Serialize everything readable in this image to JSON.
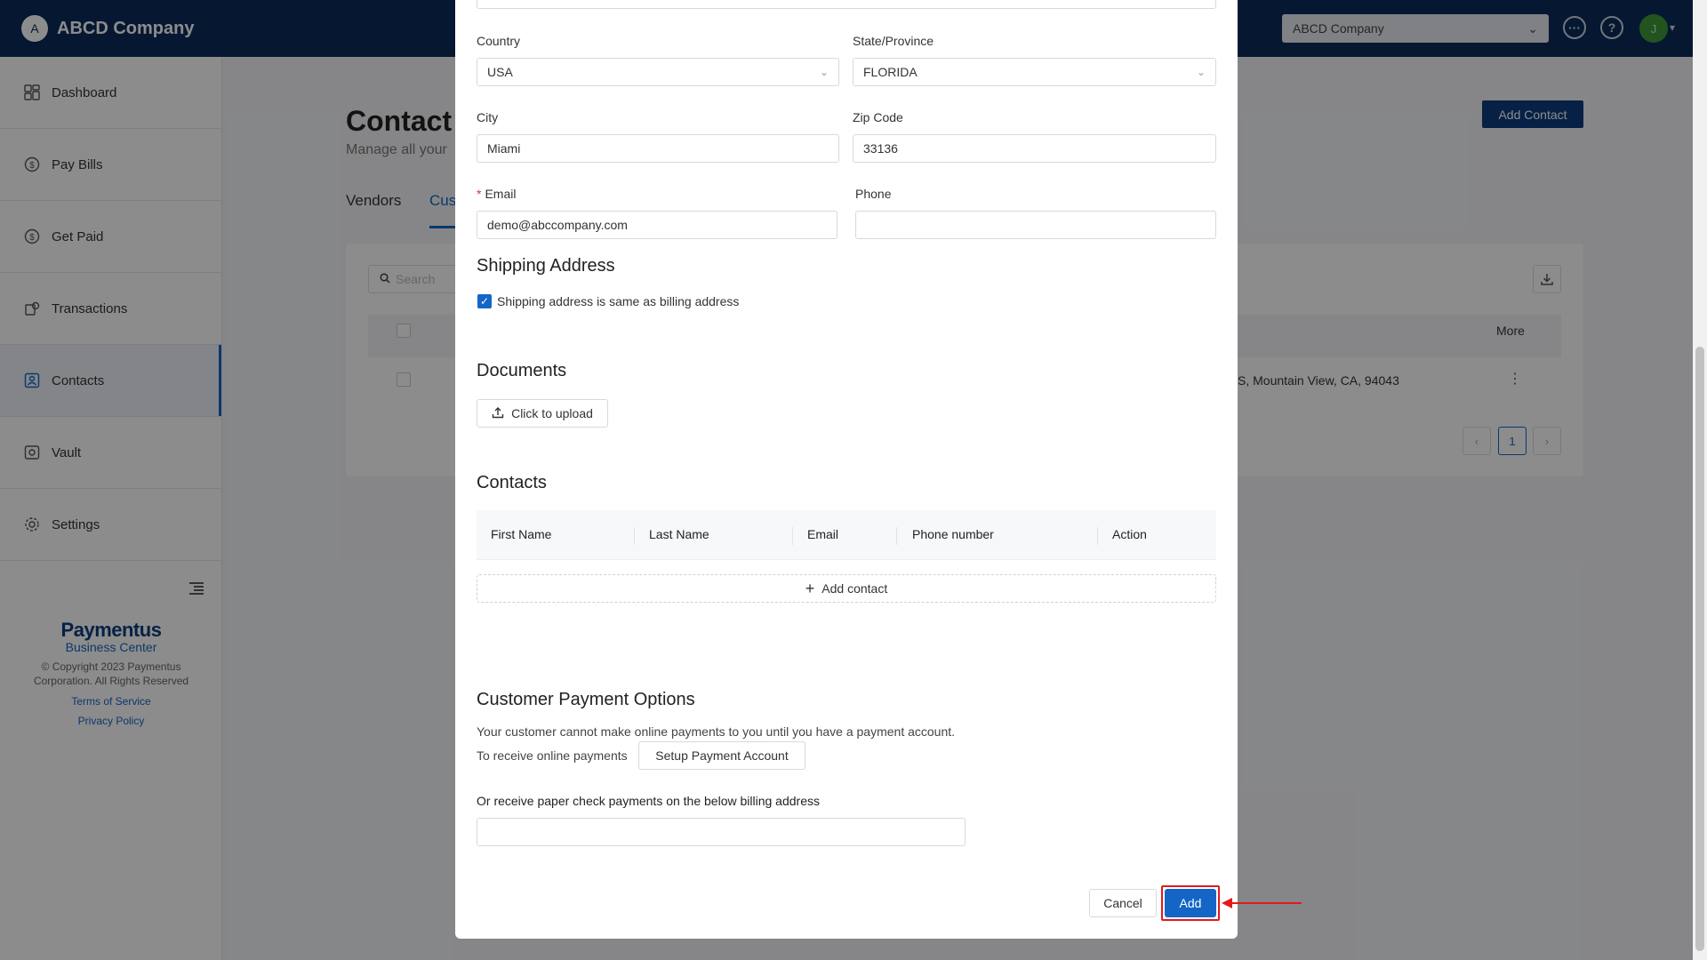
{
  "header": {
    "brand_initial": "A",
    "brand_name": "ABCD Company",
    "company_select": "ABCD Company",
    "avatar_initial": "J"
  },
  "sidebar": {
    "items": [
      {
        "label": "Dashboard",
        "icon": "dashboard-icon"
      },
      {
        "label": "Pay Bills",
        "icon": "pay-bills-icon"
      },
      {
        "label": "Get Paid",
        "icon": "get-paid-icon"
      },
      {
        "label": "Transactions",
        "icon": "transactions-icon"
      },
      {
        "label": "Contacts",
        "icon": "contacts-icon",
        "active": true
      },
      {
        "label": "Vault",
        "icon": "vault-icon"
      },
      {
        "label": "Settings",
        "icon": "settings-icon"
      }
    ],
    "footer": {
      "brand": "Paymentus",
      "sub": "Business Center",
      "copyright": "© Copyright 2023 Paymentus Corporation. All Rights Reserved",
      "terms": "Terms of Service",
      "privacy": "Privacy Policy"
    }
  },
  "background": {
    "title": "Contact",
    "subtitle": "Manage all your",
    "tabs": [
      "Vendors",
      "Cus"
    ],
    "add_contact": "Add Contact",
    "search_placeholder": "Search",
    "more_header": "More",
    "row_address": "S, Mountain View, CA, 94043",
    "current_page": "1"
  },
  "modal": {
    "country": {
      "label": "Country",
      "value": "USA"
    },
    "state": {
      "label": "State/Province",
      "value": "FLORIDA"
    },
    "city": {
      "label": "City",
      "value": "Miami"
    },
    "zip": {
      "label": "Zip Code",
      "value": "33136"
    },
    "email": {
      "label": "Email",
      "value": "demo@abccompany.com"
    },
    "phone": {
      "label": "Phone",
      "value": ""
    },
    "shipping": {
      "title": "Shipping Address",
      "same_as_billing": "Shipping address is same as billing address",
      "checked": true
    },
    "documents": {
      "title": "Documents",
      "upload_label": "Click to upload"
    },
    "contacts": {
      "title": "Contacts",
      "columns": [
        "First Name",
        "Last Name",
        "Email",
        "Phone number",
        "Action"
      ],
      "add_label": "Add contact"
    },
    "payment": {
      "title": "Customer Payment Options",
      "note": "Your customer cannot make online payments to you until you have a payment account.",
      "receive_label": "To receive online payments",
      "setup_button": "Setup Payment Account",
      "paper_label": "Or receive paper check payments on the below billing address",
      "paper_value": ""
    },
    "cancel_label": "Cancel",
    "add_label": "Add"
  },
  "colors": {
    "header_bg": "#0b2a5c",
    "primary": "#1466c6",
    "highlight": "#e01b1b"
  }
}
